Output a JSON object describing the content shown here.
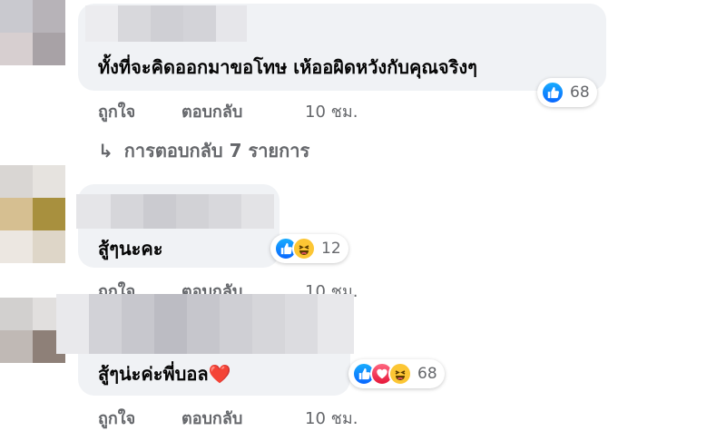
{
  "comments": [
    {
      "text": "ทั้งที่จะคิดออกมาขอโทษ เห้ออผิดหวังกับคุณจริงๆ",
      "reaction_icons": [
        "like-icon"
      ],
      "reaction_count": "68",
      "like_label": "ถูกใจ",
      "reply_label": "ตอบกลับ",
      "time": "10 ชม.",
      "replies_link": "การตอบกลับ 7 รายการ"
    },
    {
      "text": "สู้ๆนะคะ",
      "reaction_icons": [
        "like-icon",
        "haha-icon"
      ],
      "reaction_count": "12",
      "like_label": "ถูกใจ",
      "reply_label": "ตอบกลับ",
      "time": "10 ชม."
    },
    {
      "text": "สู้ๆน่ะค่ะพี่บอล❤️",
      "reaction_icons": [
        "like-icon",
        "love-icon",
        "haha-icon"
      ],
      "reaction_count": "68",
      "like_label": "ถูกใจ",
      "reply_label": "ตอบกลับ",
      "time": "10 ชม."
    }
  ],
  "colors": {
    "bubble": "#f0f2f5",
    "meta_text": "#65676b",
    "like_blue": "#0866ff",
    "love_red": "#e61739",
    "haha_yellow": "#fcc634"
  }
}
